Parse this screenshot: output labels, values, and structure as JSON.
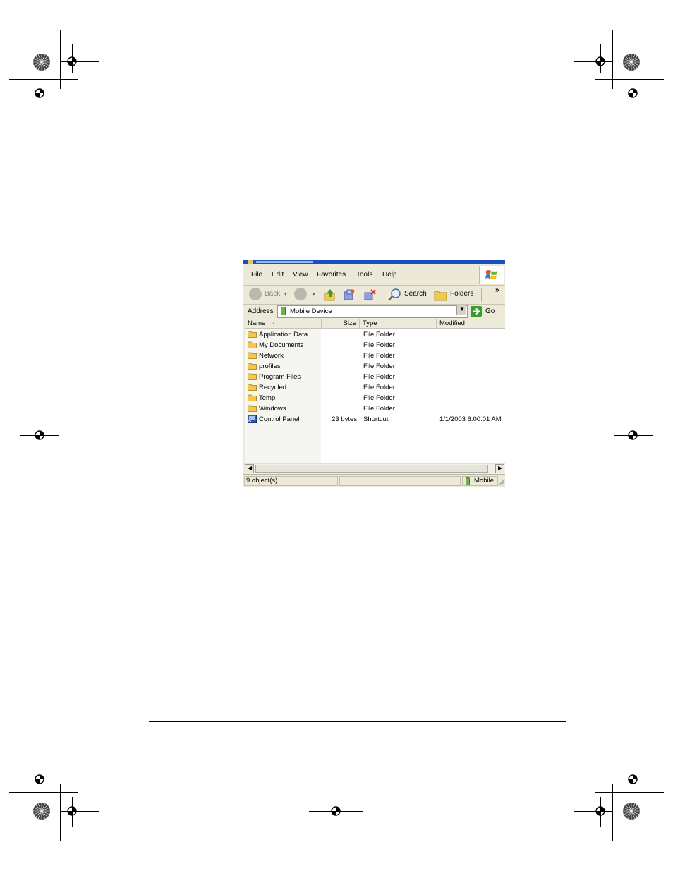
{
  "window": {
    "menu": [
      "File",
      "Edit",
      "View",
      "Favorites",
      "Tools",
      "Help"
    ],
    "toolbar": {
      "back_label": "Back",
      "search_label": "Search",
      "folders_label": "Folders",
      "more_glyph": "»"
    },
    "address": {
      "label": "Address",
      "value": "Mobile Device",
      "go_label": "Go"
    },
    "columns": {
      "name": "Name",
      "sort_glyph": "▲",
      "size": "Size",
      "type": "Type",
      "modified": "Modified"
    },
    "files": [
      {
        "name": "Application Data",
        "size": "",
        "type": "File Folder",
        "modified": "",
        "icon": "folder-icon"
      },
      {
        "name": "My Documents",
        "size": "",
        "type": "File Folder",
        "modified": "",
        "icon": "folder-icon"
      },
      {
        "name": "Network",
        "size": "",
        "type": "File Folder",
        "modified": "",
        "icon": "folder-icon"
      },
      {
        "name": "profiles",
        "size": "",
        "type": "File Folder",
        "modified": "",
        "icon": "folder-icon"
      },
      {
        "name": "Program Files",
        "size": "",
        "type": "File Folder",
        "modified": "",
        "icon": "folder-icon"
      },
      {
        "name": "Recycled",
        "size": "",
        "type": "File Folder",
        "modified": "",
        "icon": "folder-icon"
      },
      {
        "name": "Temp",
        "size": "",
        "type": "File Folder",
        "modified": "",
        "icon": "folder-icon"
      },
      {
        "name": "Windows",
        "size": "",
        "type": "File Folder",
        "modified": "",
        "icon": "folder-icon"
      },
      {
        "name": "Control Panel",
        "size": "23 bytes",
        "type": "Shortcut",
        "modified": "1/1/2003  6:00:01 AM",
        "icon": "shortcut-icon"
      }
    ],
    "status": {
      "objects": "9 object(s)",
      "zone": "Mobile"
    }
  },
  "colors": {
    "titlebar": "#1a4fc4",
    "chrome": "#ece9d8",
    "folder": "#f2c94c",
    "go_green": "#3a9c2e"
  }
}
